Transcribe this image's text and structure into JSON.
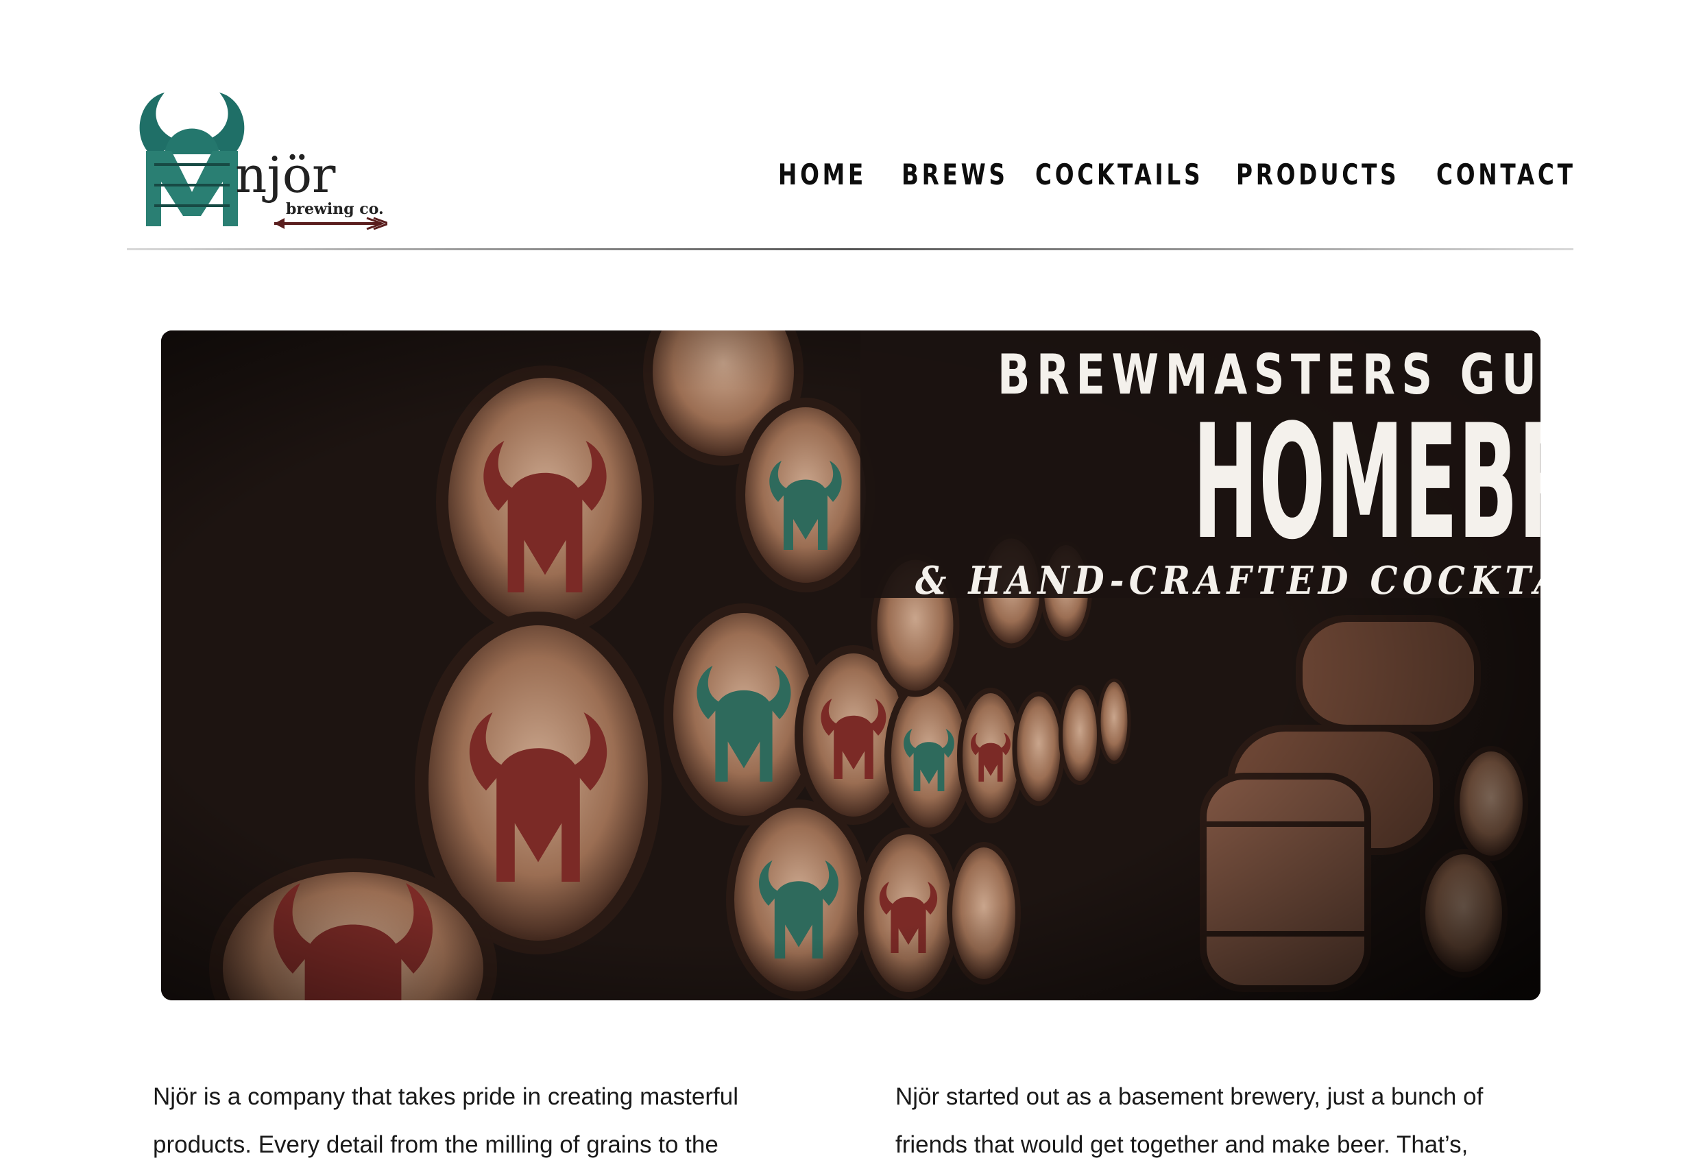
{
  "site": {
    "logo": {
      "wordmark": "njör",
      "tagline": "brewing co.",
      "colors": {
        "horns": "#1f6f67",
        "text": "#222222",
        "arrow": "#5a1e1e"
      }
    },
    "nav": {
      "items": [
        {
          "label": "HOME"
        },
        {
          "label": "BREWS"
        },
        {
          "label": "COCKTAILS"
        },
        {
          "label": "PRODUCTS"
        },
        {
          "label": "CONTACT"
        }
      ]
    }
  },
  "hero": {
    "title_line1": "BREWMASTERS GUIDE TO",
    "title_line2": "HOMEBREWING",
    "title_line3": "& HAND-CRAFTED COCKTAILS",
    "colors": {
      "background": "#1d1411",
      "barrel": "#8a5d44",
      "emblem_red": "#7b2a26",
      "emblem_green": "#2e6a5c",
      "text": "#f4f1ec"
    }
  },
  "content": {
    "left_paragraph": "Njör is a company that takes pride in creating masterful products. Every detail from the milling of grains to the",
    "right_paragraph": "Njör started out as a basement brewery, just a bunch of friends that would get together and make beer. That’s,"
  }
}
